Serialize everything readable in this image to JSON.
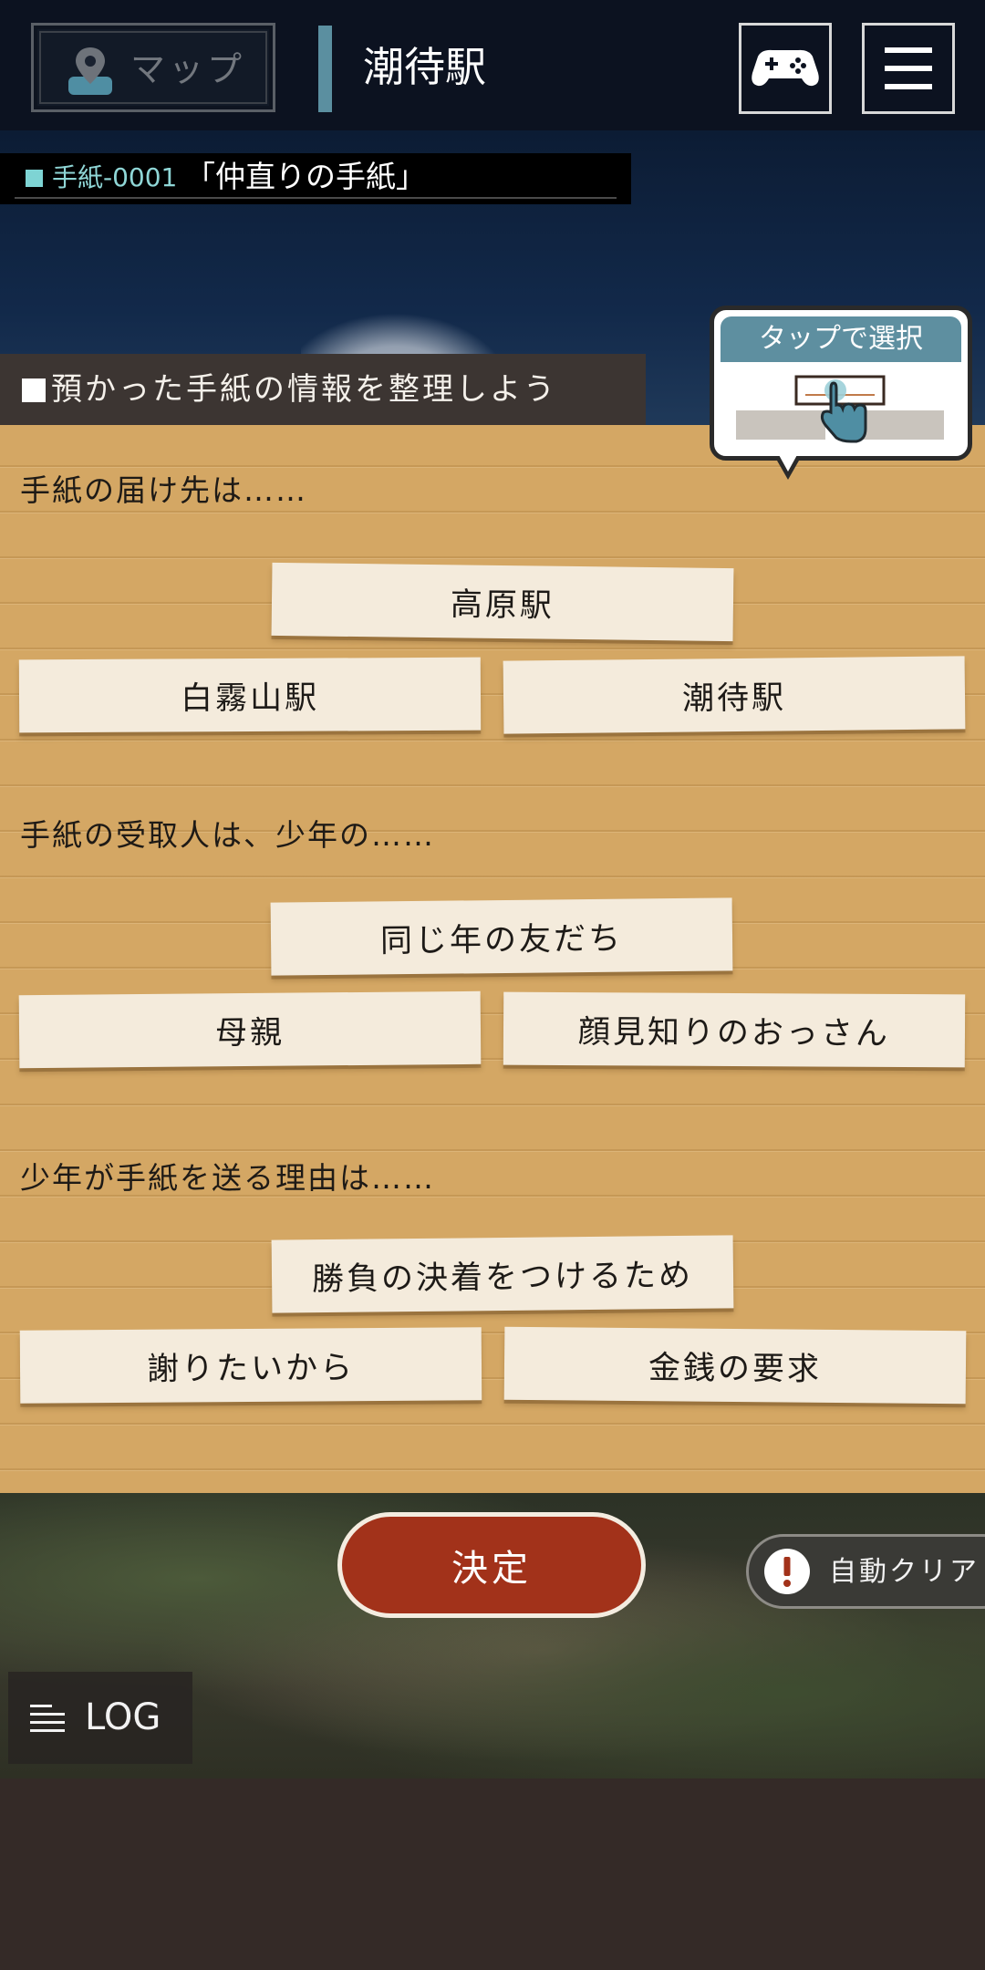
{
  "header": {
    "map_label": "マップ",
    "station": "潮待駅"
  },
  "letter": {
    "code": "手紙-0001",
    "name": "「仲直りの手紙」"
  },
  "banner": {
    "text": "預かった手紙の情報を整理しよう"
  },
  "tooltip": {
    "title": "タップで選択"
  },
  "questions": [
    {
      "prompt": "手紙の届け先は……",
      "options": [
        "高原駅",
        "白霧山駅",
        "潮待駅"
      ]
    },
    {
      "prompt": "手紙の受取人は、少年の……",
      "options": [
        "同じ年の友だち",
        "母親",
        "顔見知りのおっさん"
      ]
    },
    {
      "prompt": "少年が手紙を送る理由は……",
      "options": [
        "勝負の決着をつけるため",
        "謝りたいから",
        "金銭の要求"
      ]
    }
  ],
  "actions": {
    "decide": "決定",
    "auto_clear": "自動クリア",
    "log": "LOG"
  },
  "colors": {
    "header_bg": "#0c1220",
    "accent_teal": "#5b8fa0",
    "paper": "#d4a764",
    "card": "#f4ebdc",
    "decide_red": "#a2321a"
  }
}
